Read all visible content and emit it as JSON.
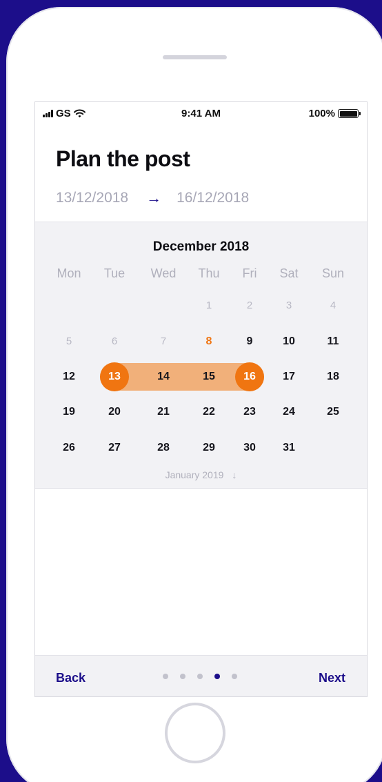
{
  "status_bar": {
    "carrier": "GS",
    "time": "9:41 AM",
    "battery": "100%",
    "battery_level": 1.0
  },
  "title": "Plan the post",
  "date_range": {
    "start": "13/12/2018",
    "arrow": "→",
    "end": "16/12/2018"
  },
  "calendar": {
    "month": "December 2018",
    "weekdays": [
      "Mon",
      "Tue",
      "Wed",
      "Thu",
      "Fri",
      "Sat",
      "Sun"
    ],
    "weeks": [
      [
        "",
        "",
        "",
        "1",
        "2",
        "3",
        "4"
      ],
      [
        "5",
        "6",
        "7",
        "8",
        "9",
        "10",
        "11"
      ],
      [
        "12",
        "13",
        "14",
        "15",
        "16",
        "17",
        "18"
      ],
      [
        "19",
        "20",
        "21",
        "22",
        "23",
        "24",
        "25"
      ],
      [
        "26",
        "27",
        "28",
        "29",
        "30",
        "31",
        ""
      ]
    ],
    "muted_days": [
      "1",
      "2",
      "3",
      "4",
      "5",
      "6",
      "7"
    ],
    "today": "8",
    "range_start": "13",
    "range_end": "16",
    "next_month": "January 2019",
    "next_month_icon": "arrow-down-icon"
  },
  "footer": {
    "back": "Back",
    "next": "Next",
    "pages": 5,
    "current_page": 4
  },
  "colors": {
    "background": "#1c0e8a",
    "accent": "#f07511",
    "range": "#f1b07a",
    "primary": "#1c0e8a"
  }
}
